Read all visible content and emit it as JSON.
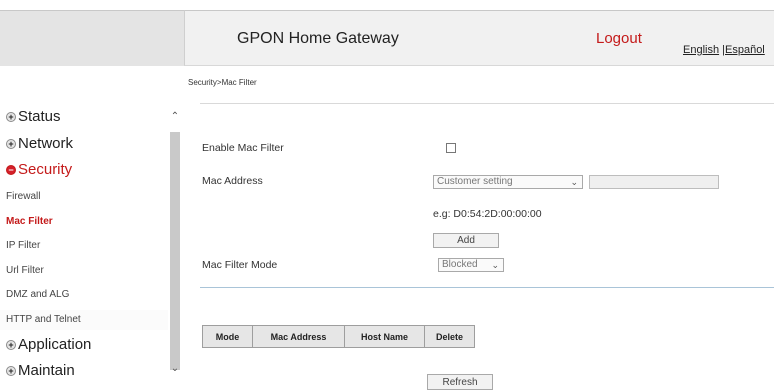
{
  "header": {
    "brand": "GPON Home Gateway",
    "logout": "Logout",
    "lang_english": "English",
    "lang_sep": " |",
    "lang_spanish": "Español"
  },
  "breadcrumb": "Security>Mac Filter",
  "sidebar": {
    "items": [
      {
        "label": "Status",
        "type": "top",
        "expanded": false
      },
      {
        "label": "Network",
        "type": "top",
        "expanded": false
      },
      {
        "label": "Security",
        "type": "top",
        "expanded": true
      },
      {
        "label": "Firewall",
        "type": "sub"
      },
      {
        "label": "Mac Filter",
        "type": "sub",
        "active": true
      },
      {
        "label": "IP Filter",
        "type": "sub"
      },
      {
        "label": "Url Filter",
        "type": "sub"
      },
      {
        "label": "DMZ and ALG",
        "type": "sub"
      },
      {
        "label": "HTTP and Telnet",
        "type": "sub"
      },
      {
        "label": "Application",
        "type": "top",
        "expanded": false
      },
      {
        "label": "Maintain",
        "type": "top",
        "expanded": false
      }
    ],
    "icons": {
      "expand": "plus-circle-icon",
      "collapse": "minus-circle-icon"
    }
  },
  "form": {
    "enable_label": "Enable Mac Filter",
    "enable_checked": false,
    "mac_label": "Mac Address",
    "mac_select_value": "Customer setting",
    "mac_input_value": "",
    "example": "e.g: D0:54:2D:00:00:00",
    "add_button": "Add",
    "mode_label": "Mac Filter Mode",
    "mode_value": "Blocked"
  },
  "table": {
    "columns": [
      "Mode",
      "Mac Address",
      "Host Name",
      "Delete"
    ]
  },
  "refresh_button": "Refresh",
  "colors": {
    "accent": "#c41a1a",
    "divider_blue": "#a9c4d8",
    "header_bg": "#f1f1f1"
  }
}
